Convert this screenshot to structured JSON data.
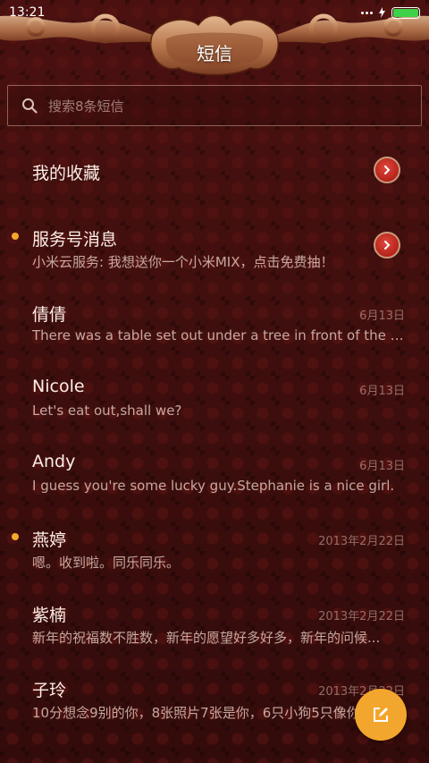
{
  "status_bar": {
    "time": "13:21",
    "battery_level": 1.0,
    "battery_color": "#3fd14a"
  },
  "header": {
    "title": "短信",
    "decoration_icon": "ornate-carved-frame"
  },
  "search": {
    "icon": "search-icon",
    "placeholder": "搜索8条短信"
  },
  "conversations": [
    {
      "name": "我的收藏",
      "preview": "",
      "date": "",
      "unread": false,
      "arrow": true
    },
    {
      "name": "服务号消息",
      "preview": "小米云服务: 我想送你一个小米MIX，点击免费抽！",
      "date": "",
      "unread": true,
      "arrow": true
    },
    {
      "name": "倩倩",
      "preview": "There was a table set out under a tree in front of the ho...",
      "date": "6月13日",
      "unread": false,
      "arrow": false
    },
    {
      "name": "Nicole",
      "preview": "Let's eat out,shall we?",
      "date": "6月13日",
      "unread": false,
      "arrow": false
    },
    {
      "name": "Andy",
      "preview": "I guess you're some lucky guy.Stephanie is a nice girl.",
      "date": "6月13日",
      "unread": false,
      "arrow": false
    },
    {
      "name": "燕婷",
      "preview": "嗯。收到啦。同乐同乐。",
      "date": "2013年2月22日",
      "unread": true,
      "arrow": false
    },
    {
      "name": "紫楠",
      "preview": "新年的祝福数不胜数，新年的愿望好多好多，新年的问候...",
      "date": "2013年2月22日",
      "unread": false,
      "arrow": false
    },
    {
      "name": "子玲",
      "preview": "10分想念9别的你，8张照片7张是你，6只小狗5只像你",
      "date": "2013年2月22日",
      "unread": false,
      "arrow": false
    }
  ],
  "fab": {
    "icon": "compose-icon"
  },
  "colors": {
    "accent": "#f3a62d",
    "unread_dot": "#f2a92c",
    "arrow_button": "#c8281f",
    "background": "#3a0d0c"
  }
}
